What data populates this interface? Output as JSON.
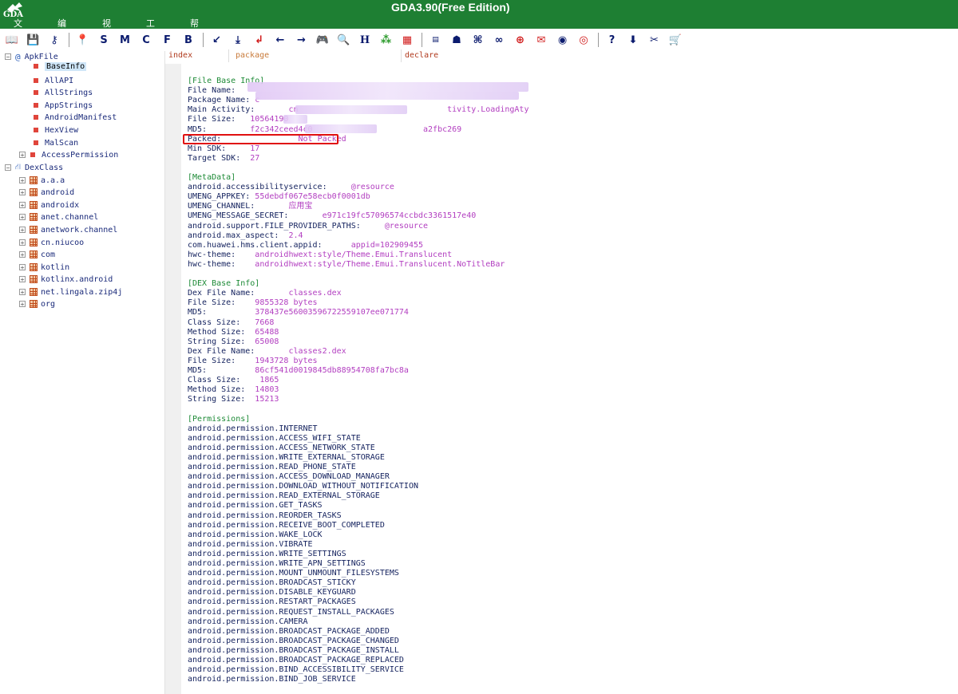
{
  "title": "GDA3.90(Free Edition)",
  "logo_text": "GDA",
  "menu": [
    "文件",
    "编辑",
    "视图",
    "工具",
    "帮助"
  ],
  "toolbar": [
    "open-book-icon",
    "save-icon",
    "key-icon",
    "pin-icon",
    "S",
    "M",
    "C",
    "F",
    "B",
    "back-check-icon",
    "download-heart-icon",
    "return-icon",
    "arrow-left-icon",
    "arrow-right-icon",
    "gamepad-icon",
    "search-doc-icon",
    "H",
    "shapes-icon",
    "grid-icon",
    "apk-icon",
    "android-icon",
    "command-icon",
    "link-icon",
    "globe-icon",
    "envelope-icon",
    "eye-icon",
    "fingerprint-icon",
    "?",
    "download-icon",
    "tools-icon",
    "cart-icon"
  ],
  "columns": {
    "index": "index",
    "package": "package",
    "declare": "declare"
  },
  "tree": {
    "apk_root": "ApkFile",
    "apk_items": [
      "BaseInfo",
      "AllAPI",
      "AllStrings",
      "AppStrings",
      "AndroidManifest",
      "HexView",
      "MalScan"
    ],
    "access_permission": "AccessPermission",
    "dex_root": "DexClass",
    "dex_items": [
      "a.a.a",
      "android",
      "androidx",
      "anet.channel",
      "anetwork.channel",
      "cn.niucoo",
      "com",
      "kotlin",
      "kotlinx.android",
      "net.lingala.zip4j",
      "org"
    ]
  },
  "info": {
    "base_header": "[File Base Info]",
    "base": [
      {
        "k": "File Name:      ",
        "v": ""
      },
      {
        "k": "Package Name: ",
        "v": "c"
      },
      {
        "k": "Main Activity:       ",
        "v": "cn                               tivity.LoadingAty"
      },
      {
        "k": "File Size:   ",
        "v": "10564190"
      },
      {
        "k": "MD5:         ",
        "v": "f2c342ceed4c0                       a2fbc269"
      },
      {
        "k": "Packed:                ",
        "v": "Not Packed"
      },
      {
        "k": "Min SDK:     ",
        "v": "17"
      },
      {
        "k": "Target SDK:  ",
        "v": "27"
      }
    ],
    "meta_header": "[MetaData]",
    "meta": [
      {
        "k": "android.accessibilityservice:     ",
        "v": "@resource"
      },
      {
        "k": "UMENG_APPKEY: ",
        "v": "55debdf067e58ecb0f0001db"
      },
      {
        "k": "UMENG_CHANNEL:       ",
        "v": "应用宝"
      },
      {
        "k": "UMENG_MESSAGE_SECRET:       ",
        "v": "e971c19fc57096574ccbdc3361517e40"
      },
      {
        "k": "android.support.FILE_PROVIDER_PATHS:     ",
        "v": "@resource"
      },
      {
        "k": "android.max_aspect:  ",
        "v": "2.4"
      },
      {
        "k": "com.huawei.hms.client.appid:      ",
        "v": "appid=102909455"
      },
      {
        "k": "hwc-theme:    ",
        "v": "androidhwext:style/Theme.Emui.Translucent"
      },
      {
        "k": "hwc-theme:    ",
        "v": "androidhwext:style/Theme.Emui.Translucent.NoTitleBar"
      }
    ],
    "dex_header": "[DEX Base Info]",
    "dex": [
      {
        "k": "Dex File Name:       ",
        "v": "classes.dex"
      },
      {
        "k": "File Size:    ",
        "v": "9855328 bytes"
      },
      {
        "k": "MD5:          ",
        "v": "378437e56003596722559107ee071774"
      },
      {
        "k": "Class Size:   ",
        "v": "7668"
      },
      {
        "k": "Method Size:  ",
        "v": "65488"
      },
      {
        "k": "String Size:  ",
        "v": "65008"
      },
      {
        "k": "Dex File Name:       ",
        "v": "classes2.dex"
      },
      {
        "k": "File Size:    ",
        "v": "1943728 bytes"
      },
      {
        "k": "MD5:          ",
        "v": "86cf541d0019845db88954708fa7bc8a"
      },
      {
        "k": "Class Size:    ",
        "v": "1865"
      },
      {
        "k": "Method Size:  ",
        "v": "14803"
      },
      {
        "k": "String Size:  ",
        "v": "15213"
      }
    ],
    "perm_header": "[Permissions]",
    "permissions": [
      "android.permission.INTERNET",
      "android.permission.ACCESS_WIFI_STATE",
      "android.permission.ACCESS_NETWORK_STATE",
      "android.permission.WRITE_EXTERNAL_STORAGE",
      "android.permission.READ_PHONE_STATE",
      "android.permission.ACCESS_DOWNLOAD_MANAGER",
      "android.permission.DOWNLOAD_WITHOUT_NOTIFICATION",
      "android.permission.READ_EXTERNAL_STORAGE",
      "android.permission.GET_TASKS",
      "android.permission.REORDER_TASKS",
      "android.permission.RECEIVE_BOOT_COMPLETED",
      "android.permission.WAKE_LOCK",
      "android.permission.VIBRATE",
      "android.permission.WRITE_SETTINGS",
      "android.permission.WRITE_APN_SETTINGS",
      "android.permission.MOUNT_UNMOUNT_FILESYSTEMS",
      "android.permission.BROADCAST_STICKY",
      "android.permission.DISABLE_KEYGUARD",
      "android.permission.RESTART_PACKAGES",
      "android.permission.REQUEST_INSTALL_PACKAGES",
      "android.permission.CAMERA",
      "android.permission.BROADCAST_PACKAGE_ADDED",
      "android.permission.BROADCAST_PACKAGE_CHANGED",
      "android.permission.BROADCAST_PACKAGE_INSTALL",
      "android.permission.BROADCAST_PACKAGE_REPLACED",
      "android.permission.BIND_ACCESSIBILITY_SERVICE",
      "android.permission.BIND_JOB_SERVICE"
    ]
  },
  "colors": {
    "titlebar": "#1e7f33",
    "value": "#b23ec0",
    "section": "#1d8a36",
    "key": "#14225e",
    "highlight": "#e01010"
  }
}
